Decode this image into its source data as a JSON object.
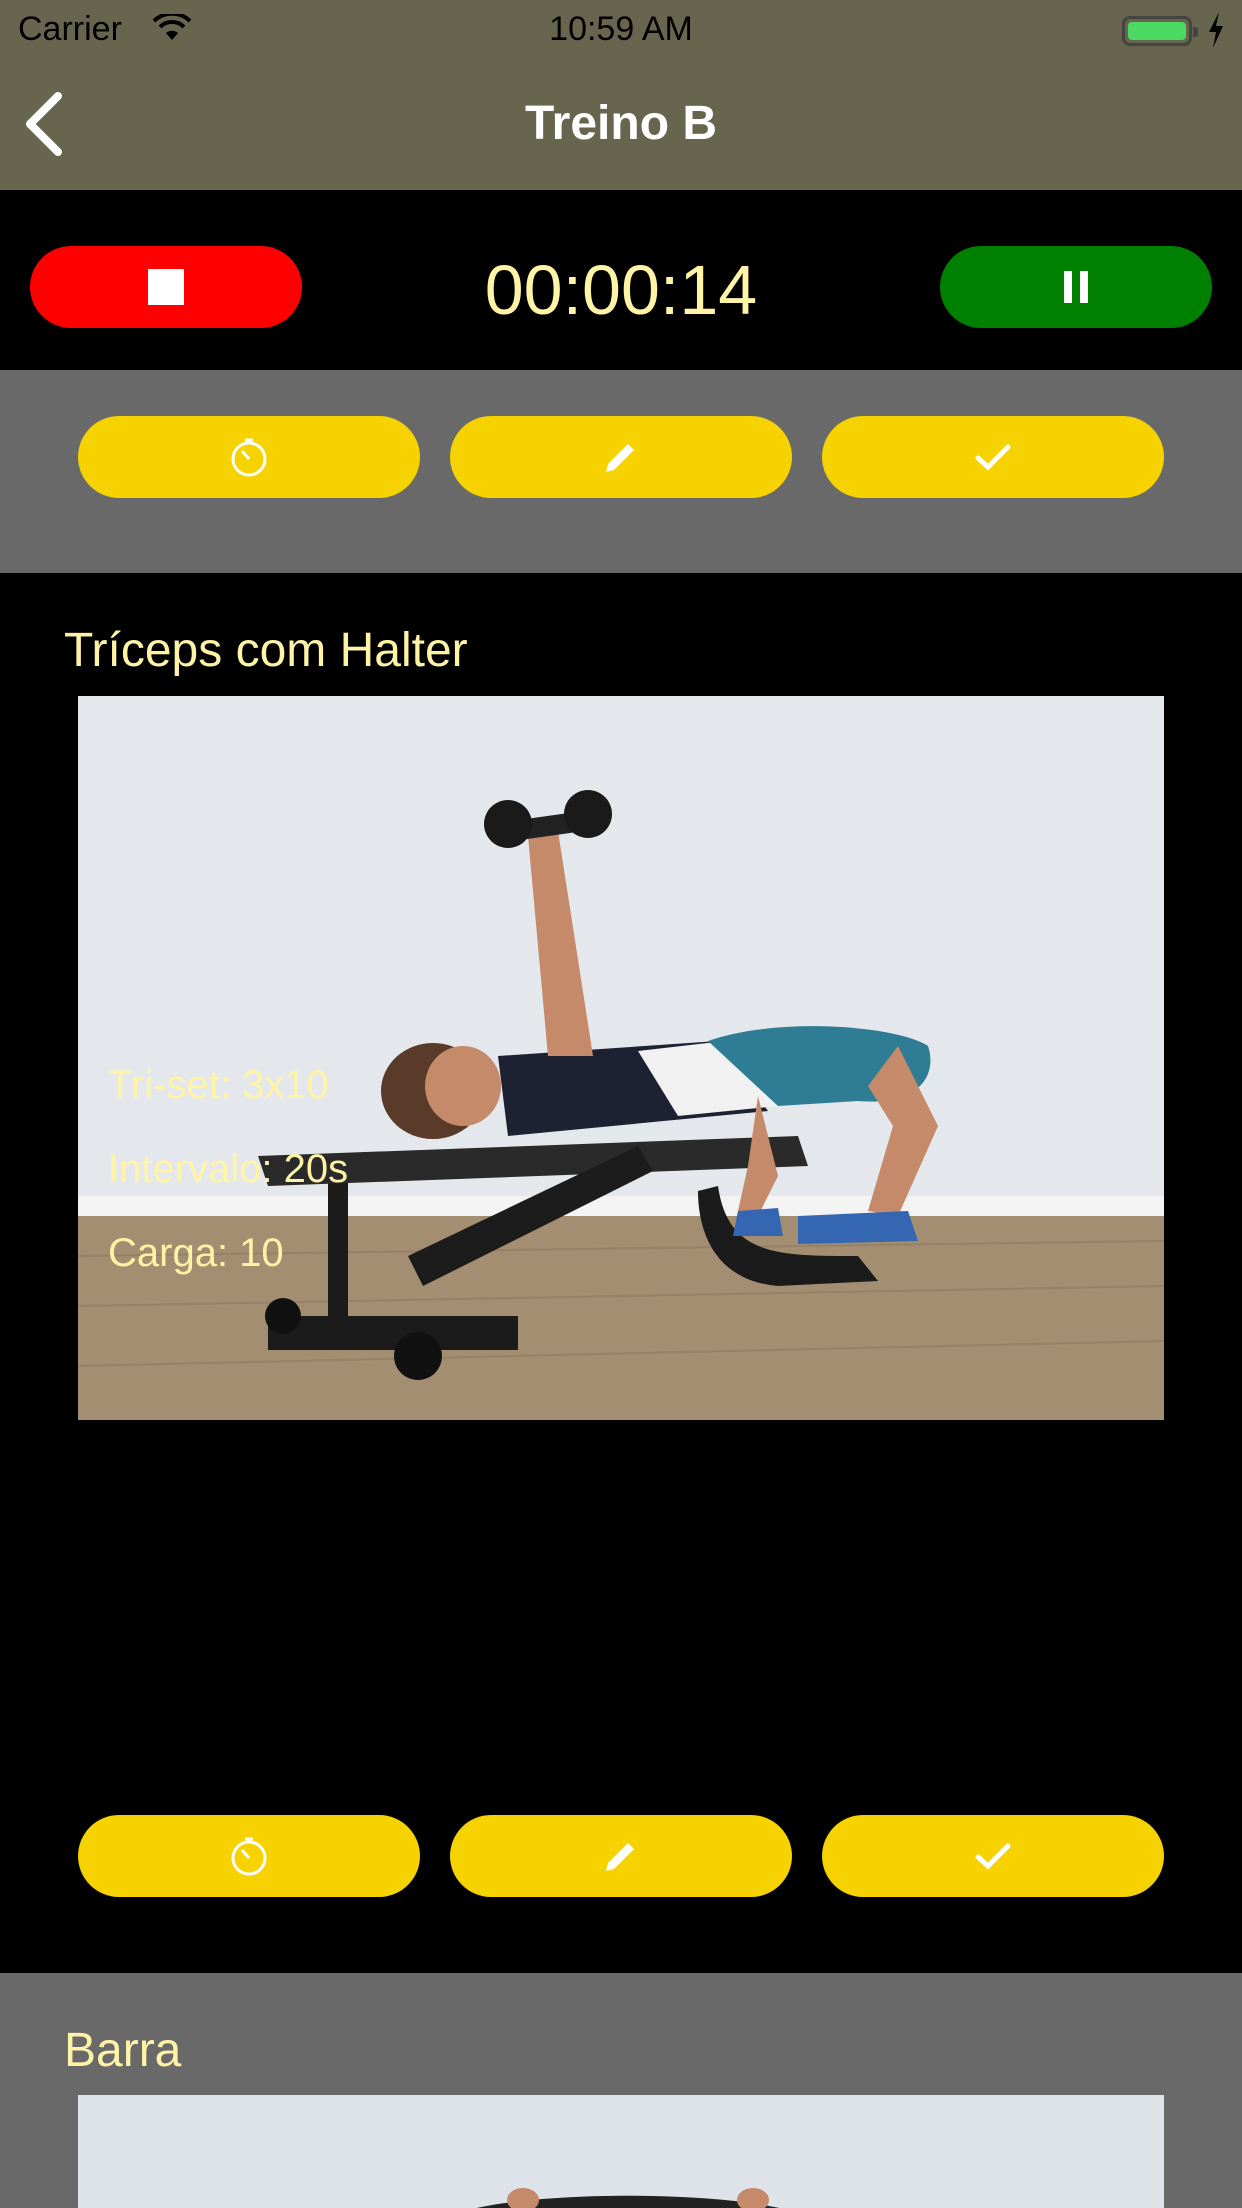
{
  "status_bar": {
    "carrier": "Carrier",
    "time": "10:59 AM"
  },
  "nav": {
    "title": "Treino B",
    "back_icon": "chevron-left-icon"
  },
  "timer": {
    "value": "00:00:14",
    "stop_icon": "stop-icon",
    "pause_icon": "pause-icon"
  },
  "actions": [
    {
      "icon": "timer-icon"
    },
    {
      "icon": "pencil-icon"
    },
    {
      "icon": "check-icon"
    }
  ],
  "exercises": [
    {
      "title": "Tríceps com Halter",
      "details": [
        "Tri-set: 3x10",
        "Intervalo: 20s",
        "Carga: 10"
      ]
    },
    {
      "title": "Barra"
    }
  ],
  "colors": {
    "nav_bg": "#68654f",
    "stop": "#ff0000",
    "pause": "#008000",
    "action": "#f5d200",
    "text_accent": "#fff3a6",
    "row_grey": "#696969"
  }
}
